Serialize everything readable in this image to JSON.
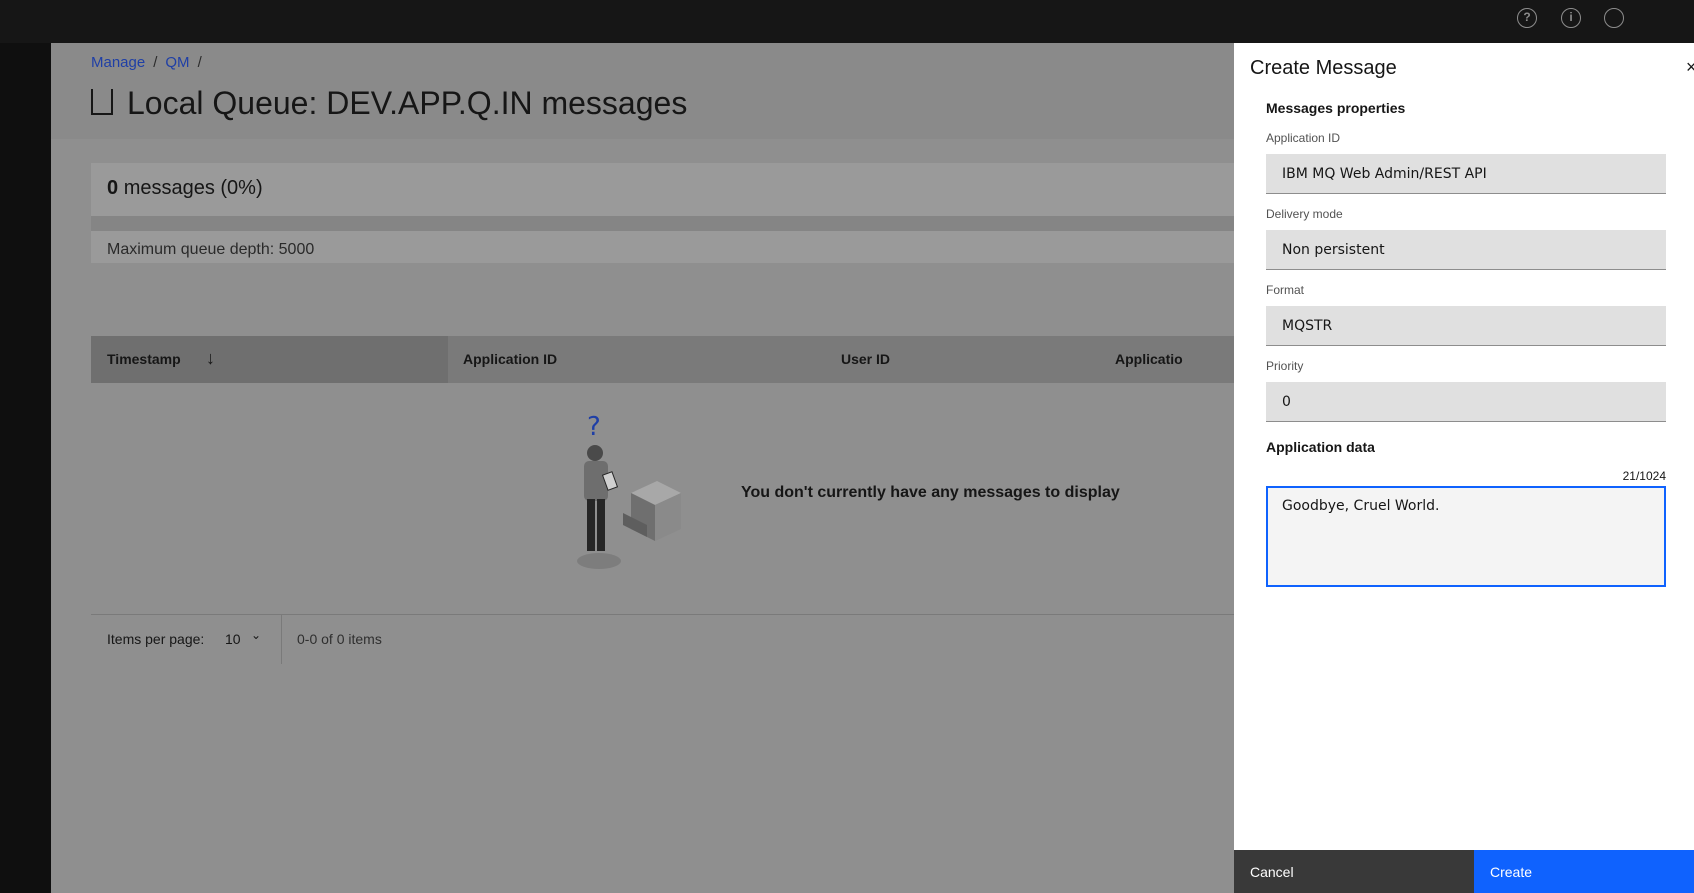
{
  "topbar": {
    "icons": [
      "help-icon",
      "info-icon",
      "user-icon"
    ]
  },
  "breadcrumb": {
    "items": [
      "Manage",
      "QM"
    ],
    "separator": "/"
  },
  "page": {
    "title": "Local Queue: DEV.APP.Q.IN messages"
  },
  "depth": {
    "count": "0",
    "label": "messages (0%)",
    "max": "Maximum queue depth: 5000",
    "fill_percent": 0
  },
  "table": {
    "columns": [
      "Timestamp",
      "Application ID",
      "User ID",
      "Applicatio"
    ],
    "empty_message": "You don't currently have any messages to display",
    "question_mark": "?",
    "sort_indicator": "↓"
  },
  "pagination": {
    "items_per_page_label": "Items per page:",
    "items_per_page_value": "10",
    "range": "0-0 of 0 items"
  },
  "panel": {
    "title": "Create Message",
    "close": "×",
    "section_properties": "Messages properties",
    "fields": [
      {
        "label": "Application ID",
        "value": "IBM MQ Web Admin/REST API"
      },
      {
        "label": "Delivery mode",
        "value": "Non persistent"
      },
      {
        "label": "Format",
        "value": "MQSTR"
      },
      {
        "label": "Priority",
        "value": "0"
      }
    ],
    "section_data": "Application data",
    "counter": "21/1024",
    "data_value": "Goodbye, Cruel World.",
    "cancel": "Cancel",
    "create": "Create"
  },
  "colors": {
    "primary": "#0f62fe",
    "overlay": "#8f8f8f",
    "topbar": "#161616"
  }
}
